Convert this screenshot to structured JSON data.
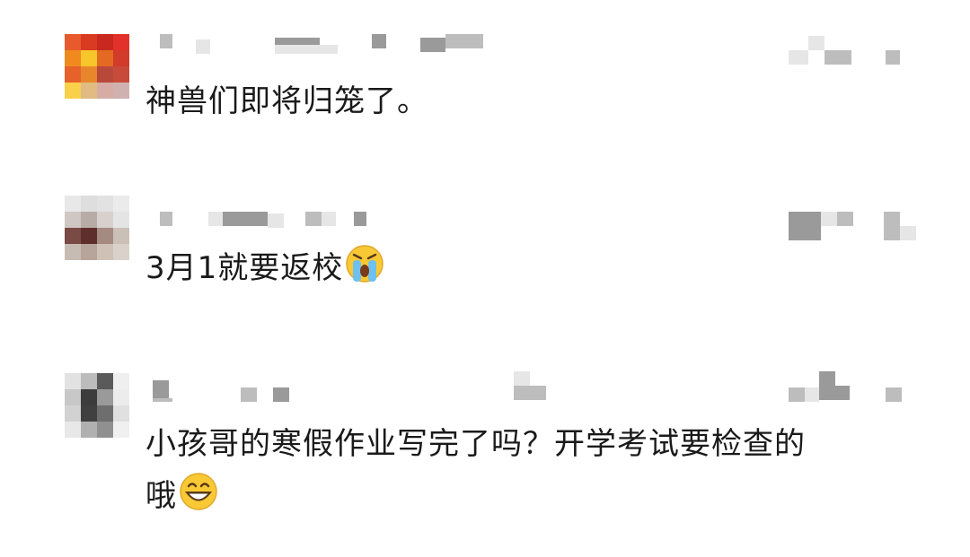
{
  "comments": [
    {
      "avatar_colors": [
        "#e85a2c",
        "#d83a22",
        "#c8281e",
        "#e2312a",
        "#f08a1e",
        "#f6c62a",
        "#e46a22",
        "#d23a2a",
        "#e6622a",
        "#e8862c",
        "#b8483a",
        "#c84a3a",
        "#f8d04a",
        "#e0bc82",
        "#d6aca4",
        "#cfb2b0"
      ],
      "text": "神兽们即将归笼了。",
      "emoji": ""
    },
    {
      "avatar_colors": [
        "#e8e8e8",
        "#dedede",
        "#e2e2e2",
        "#ebebeb",
        "#cfc7c2",
        "#b8aca6",
        "#d8d0cc",
        "#e4e4e4",
        "#7a4a44",
        "#5e2e2c",
        "#a48a80",
        "#cbc0b8",
        "#c7bcb4",
        "#b7a49a",
        "#cfc1b6",
        "#dad2ca"
      ],
      "text": "3月1就要返校",
      "emoji": "crying-face"
    },
    {
      "avatar_colors": [
        "#e2e2e2",
        "#bcbcbc",
        "#5a5a5a",
        "#efefef",
        "#c8c8c8",
        "#3c3c3c",
        "#9a9a9a",
        "#ececec",
        "#d2d2d2",
        "#404040",
        "#6e6e6e",
        "#e0e0e0",
        "#e8e8e8",
        "#b0b0b0",
        "#909090",
        "#f0f0f0"
      ],
      "text_line1": "小孩哥的寒假作业写完了吗？开学考试要检查的",
      "text_line2": "哦",
      "emoji": "grinning-face"
    }
  ]
}
